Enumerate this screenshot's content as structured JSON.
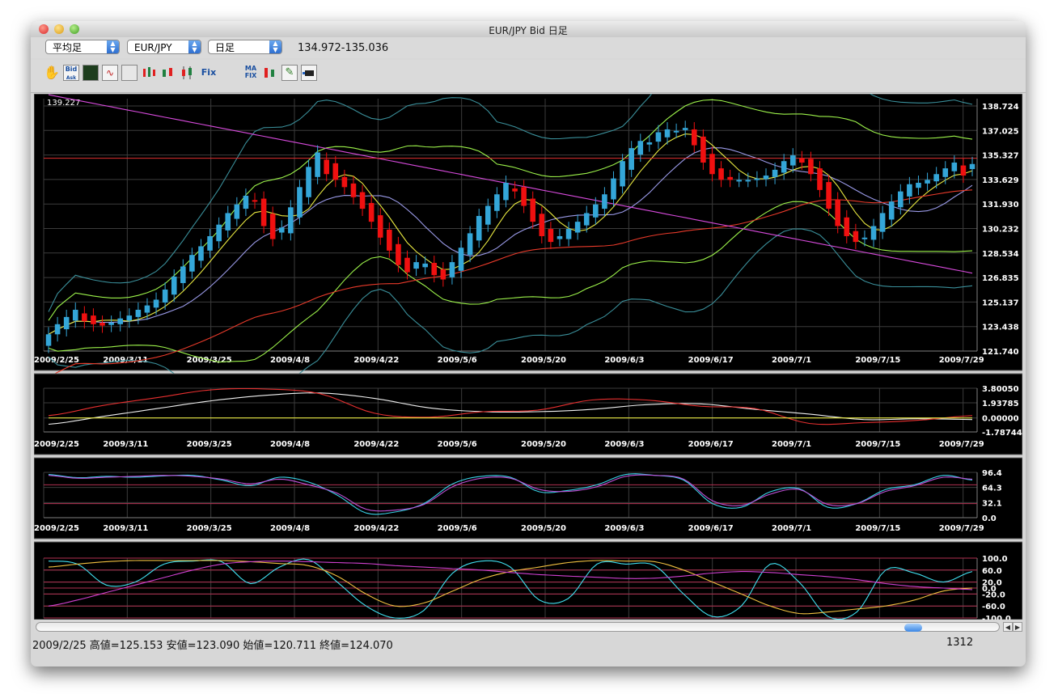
{
  "window": {
    "title": "EUR/JPY Bid 日足"
  },
  "selectors": {
    "chart_type": "平均足",
    "pair": "EUR/JPY",
    "period": "日足",
    "price_range": "134.972-135.036"
  },
  "toolbar": {
    "icons": [
      "hand-icon",
      "bid-ask-icon",
      "indicator-icon",
      "line-icon",
      "candle-icon",
      "candle-icon-2",
      "candle-icon-3",
      "candle-icon-4",
      "fix-icon",
      "ma-fix-icon",
      "candle-icon-5",
      "pen-icon",
      "camera-icon"
    ],
    "bid_label": "Bid",
    "ask_label": "Ask",
    "fix_label": "Fix",
    "ma_label": "MA",
    "mafix_label": "FIX"
  },
  "status": {
    "text": "2009/2/25  高値=125.153 安値=123.090 始値=120.711 終値=124.070",
    "count": "1312"
  },
  "colors": {
    "up": "#34a6d8",
    "down": "#f01010",
    "background": "#000000"
  },
  "chart_data": [
    {
      "type": "candlestick",
      "top_left_label": "139.227",
      "x_labels": [
        "2009/2/25",
        "2009/3/11",
        "2009/3/25",
        "2009/4/8",
        "2009/4/22",
        "2009/5/6",
        "2009/5/20",
        "2009/6/3",
        "2009/6/17",
        "2009/7/1",
        "2009/7/15",
        "2009/7/29"
      ],
      "y_labels": [
        "138.724",
        "137.025",
        "135.327",
        "133.629",
        "131.930",
        "130.232",
        "128.534",
        "126.835",
        "125.137",
        "123.438",
        "121.740"
      ],
      "ylim": [
        121.74,
        139.227
      ],
      "hline": 135.1,
      "close": [
        122.9,
        123.6,
        124.1,
        124.6,
        123.8,
        123.6,
        123.5,
        123.7,
        124.0,
        124.2,
        124.6,
        124.9,
        125.3,
        126.0,
        126.9,
        127.6,
        128.4,
        129.0,
        129.7,
        130.5,
        131.3,
        131.9,
        132.5,
        132.1,
        130.4,
        129.5,
        130.3,
        131.7,
        133.1,
        134.5,
        135.5,
        134.0,
        133.6,
        133.1,
        132.4,
        131.6,
        130.7,
        129.6,
        128.7,
        127.7,
        127.2,
        127.9,
        127.8,
        127.0,
        126.7,
        127.9,
        128.9,
        129.9,
        131.1,
        131.8,
        132.6,
        133.4,
        132.8,
        131.8,
        130.7,
        129.7,
        129.3,
        129.7,
        130.2,
        130.7,
        131.3,
        131.9,
        132.6,
        133.7,
        134.9,
        135.8,
        136.3,
        136.2,
        136.9,
        137.1,
        137.0,
        137.2,
        136.0,
        134.8,
        134.0,
        133.6,
        133.6,
        133.6,
        133.6,
        133.7,
        133.9,
        134.3,
        134.9,
        135.3,
        134.8,
        134.0,
        132.9,
        131.6,
        130.4,
        129.7,
        129.3,
        129.6,
        130.4,
        131.3,
        132.1,
        132.8,
        133.3,
        133.4,
        133.6,
        134.0,
        134.4,
        134.8,
        133.9,
        134.7
      ],
      "series": [
        {
          "name": "",
          "color": "#d64adb",
          "kind": "line"
        },
        {
          "name": "",
          "color": "#e83a2a",
          "kind": "line"
        },
        {
          "name": "",
          "color": "#e8e840",
          "kind": "line"
        },
        {
          "name": "",
          "color": "#9a9ae8",
          "kind": "line"
        },
        {
          "name": "",
          "color": "#9cf24a",
          "kind": "line"
        },
        {
          "name": "",
          "color": "#3a8f9a",
          "kind": "line"
        }
      ]
    },
    {
      "type": "line",
      "x_labels": [
        "2009/2/25",
        "2009/3/11",
        "2009/3/25",
        "2009/4/8",
        "2009/4/22",
        "2009/5/6",
        "2009/5/20",
        "2009/6/3",
        "2009/6/17",
        "2009/7/1",
        "2009/7/15",
        "2009/7/29"
      ],
      "y_labels": [
        "3.80050",
        "1.93785",
        "0.00000",
        "-1.78744"
      ],
      "ylim": [
        -1.78744,
        3.8005
      ],
      "series": [
        {
          "name": "",
          "color": "#f0f0f0",
          "values": [
            -0.8,
            0.2,
            1.2,
            2.2,
            2.9,
            3.2,
            2.5,
            1.3,
            0.8,
            0.8,
            1.1,
            1.7,
            1.8,
            1.1,
            0.5,
            -0.2,
            -0.1,
            -0.2
          ]
        },
        {
          "name": "",
          "color": "#e83030",
          "values": [
            0.3,
            1.6,
            2.6,
            3.6,
            3.7,
            3.1,
            0.6,
            0.1,
            0.8,
            1.0,
            2.3,
            2.3,
            1.5,
            1.2,
            -0.7,
            -0.6,
            -0.3,
            0.3
          ]
        },
        {
          "name": "",
          "color": "#e8e840",
          "values": [
            0.0,
            0.0,
            0.0,
            0.0,
            0.0,
            0.0,
            0.0,
            0.0,
            0.0,
            0.0,
            0.0,
            0.0,
            0.0,
            0.0,
            0.0,
            0.0,
            0.0,
            0.0
          ]
        }
      ]
    },
    {
      "type": "line",
      "x_labels": [
        "2009/2/25",
        "2009/3/11",
        "2009/3/25",
        "2009/4/8",
        "2009/4/22",
        "2009/5/6",
        "2009/5/20",
        "2009/6/3",
        "2009/6/17",
        "2009/7/1",
        "2009/7/15",
        "2009/7/29"
      ],
      "y_labels": [
        "96.4",
        "64.3",
        "32.1",
        "0.0"
      ],
      "ylim": [
        0,
        96.4
      ],
      "hlines": [
        70,
        30
      ],
      "series": [
        {
          "name": "",
          "color": "#3ad2e8",
          "values": [
            92,
            85,
            88,
            86,
            89,
            90,
            80,
            68,
            86,
            76,
            48,
            10,
            12,
            30,
            72,
            88,
            86,
            55,
            58,
            70,
            92,
            90,
            80,
            30,
            22,
            55,
            62,
            22,
            30,
            60,
            70,
            90,
            80
          ]
        },
        {
          "name": "",
          "color": "#c050d8",
          "values": [
            90,
            84,
            86,
            88,
            90,
            88,
            82,
            72,
            82,
            70,
            52,
            18,
            16,
            28,
            66,
            84,
            84,
            60,
            56,
            66,
            88,
            90,
            82,
            36,
            26,
            50,
            60,
            28,
            30,
            56,
            68,
            86,
            82
          ]
        }
      ]
    },
    {
      "type": "line",
      "x_labels": [
        "2009/2/25",
        "2009/3/11",
        "2009/3/25",
        "2009/4/8",
        "2009/4/22",
        "2009/5/6",
        "2009/5/20",
        "2009/6/3",
        "2009/6/17",
        "2009/7/1",
        "2009/7/15",
        "2009/7/29"
      ],
      "y_labels": [
        "100.0",
        "60.0",
        "20.0",
        "0.0",
        "-20.0",
        "-60.0",
        "-100.0"
      ],
      "ylim": [
        -100,
        100
      ],
      "hlines": [
        100,
        60,
        20,
        0,
        -20,
        -60,
        -100
      ],
      "series": [
        {
          "name": "",
          "color": "#40e0f0",
          "values": [
            90,
            80,
            10,
            20,
            80,
            90,
            88,
            15,
            70,
            95,
            20,
            -60,
            -100,
            -75,
            50,
            90,
            70,
            -40,
            -35,
            80,
            80,
            75,
            -20,
            -95,
            -60,
            80,
            20,
            -95,
            -80,
            60,
            50,
            20,
            55
          ]
        },
        {
          "name": "",
          "color": "#f0c040",
          "values": [
            70,
            80,
            88,
            92,
            92,
            92,
            92,
            88,
            82,
            75,
            40,
            -20,
            -60,
            -50,
            -10,
            30,
            55,
            70,
            85,
            92,
            90,
            88,
            60,
            20,
            -20,
            -60,
            -85,
            -80,
            -70,
            -60,
            -40,
            -10,
            0
          ]
        },
        {
          "name": "",
          "color": "#d040d0",
          "values": [
            -60,
            -40,
            -15,
            10,
            35,
            60,
            80,
            88,
            90,
            88,
            85,
            82,
            75,
            70,
            65,
            60,
            52,
            45,
            40,
            36,
            32,
            33,
            40,
            50,
            55,
            52,
            45,
            38,
            28,
            15,
            5,
            0,
            -5
          ]
        }
      ]
    }
  ]
}
